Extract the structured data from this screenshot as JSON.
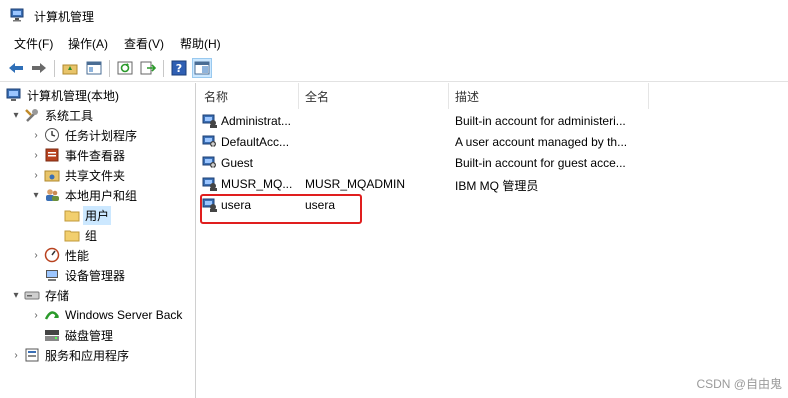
{
  "window": {
    "title": "计算机管理"
  },
  "menu": [
    {
      "label": "文件(F)"
    },
    {
      "label": "操作(A)"
    },
    {
      "label": "查看(V)"
    },
    {
      "label": "帮助(H)"
    }
  ],
  "toolbar": {
    "buttons": [
      "back-icon",
      "forward-icon",
      "up-folder-icon",
      "show-hide-tree-icon",
      "refresh-icon",
      "export-list-icon",
      "help-icon",
      "properties-pane-icon"
    ]
  },
  "tree": [
    {
      "label": "计算机管理(本地)",
      "icon": "computer-management-icon",
      "arrow": ""
    },
    {
      "label": "系统工具",
      "icon": "system-tools-icon",
      "arrow": "▾"
    },
    {
      "label": "任务计划程序",
      "icon": "task-scheduler-icon",
      "arrow": "›"
    },
    {
      "label": "事件查看器",
      "icon": "event-viewer-icon",
      "arrow": "›"
    },
    {
      "label": "共享文件夹",
      "icon": "shared-folders-icon",
      "arrow": "›"
    },
    {
      "label": "本地用户和组",
      "icon": "local-users-groups-icon",
      "arrow": "▾"
    },
    {
      "label": "用户",
      "icon": "folder-icon",
      "arrow": "",
      "selected": true
    },
    {
      "label": "组",
      "icon": "folder-icon",
      "arrow": ""
    },
    {
      "label": "性能",
      "icon": "performance-icon",
      "arrow": "›"
    },
    {
      "label": "设备管理器",
      "icon": "device-manager-icon",
      "arrow": ""
    },
    {
      "label": "存储",
      "icon": "storage-icon",
      "arrow": "▾"
    },
    {
      "label": "Windows Server Back",
      "icon": "windows-server-backup-icon",
      "arrow": "›"
    },
    {
      "label": "磁盘管理",
      "icon": "disk-management-icon",
      "arrow": ""
    },
    {
      "label": "服务和应用程序",
      "icon": "services-applications-icon",
      "arrow": "›"
    }
  ],
  "list": {
    "columns": [
      "名称",
      "全名",
      "描述"
    ],
    "rows": [
      {
        "name": "Administrat...",
        "fullname": "",
        "description": "Built-in account for administeri..."
      },
      {
        "name": "DefaultAcc...",
        "fullname": "",
        "description": "A user account managed by th..."
      },
      {
        "name": "Guest",
        "fullname": "",
        "description": "Built-in account for guest acce..."
      },
      {
        "name": "MUSR_MQ...",
        "fullname": "MUSR_MQADMIN",
        "description": "IBM MQ 管理员"
      },
      {
        "name": "usera",
        "fullname": "usera",
        "description": ""
      }
    ]
  },
  "watermark": "CSDN @自由鬼",
  "colors": {
    "highlight_box": "#e01e1e",
    "selection": "#cce8ff"
  }
}
